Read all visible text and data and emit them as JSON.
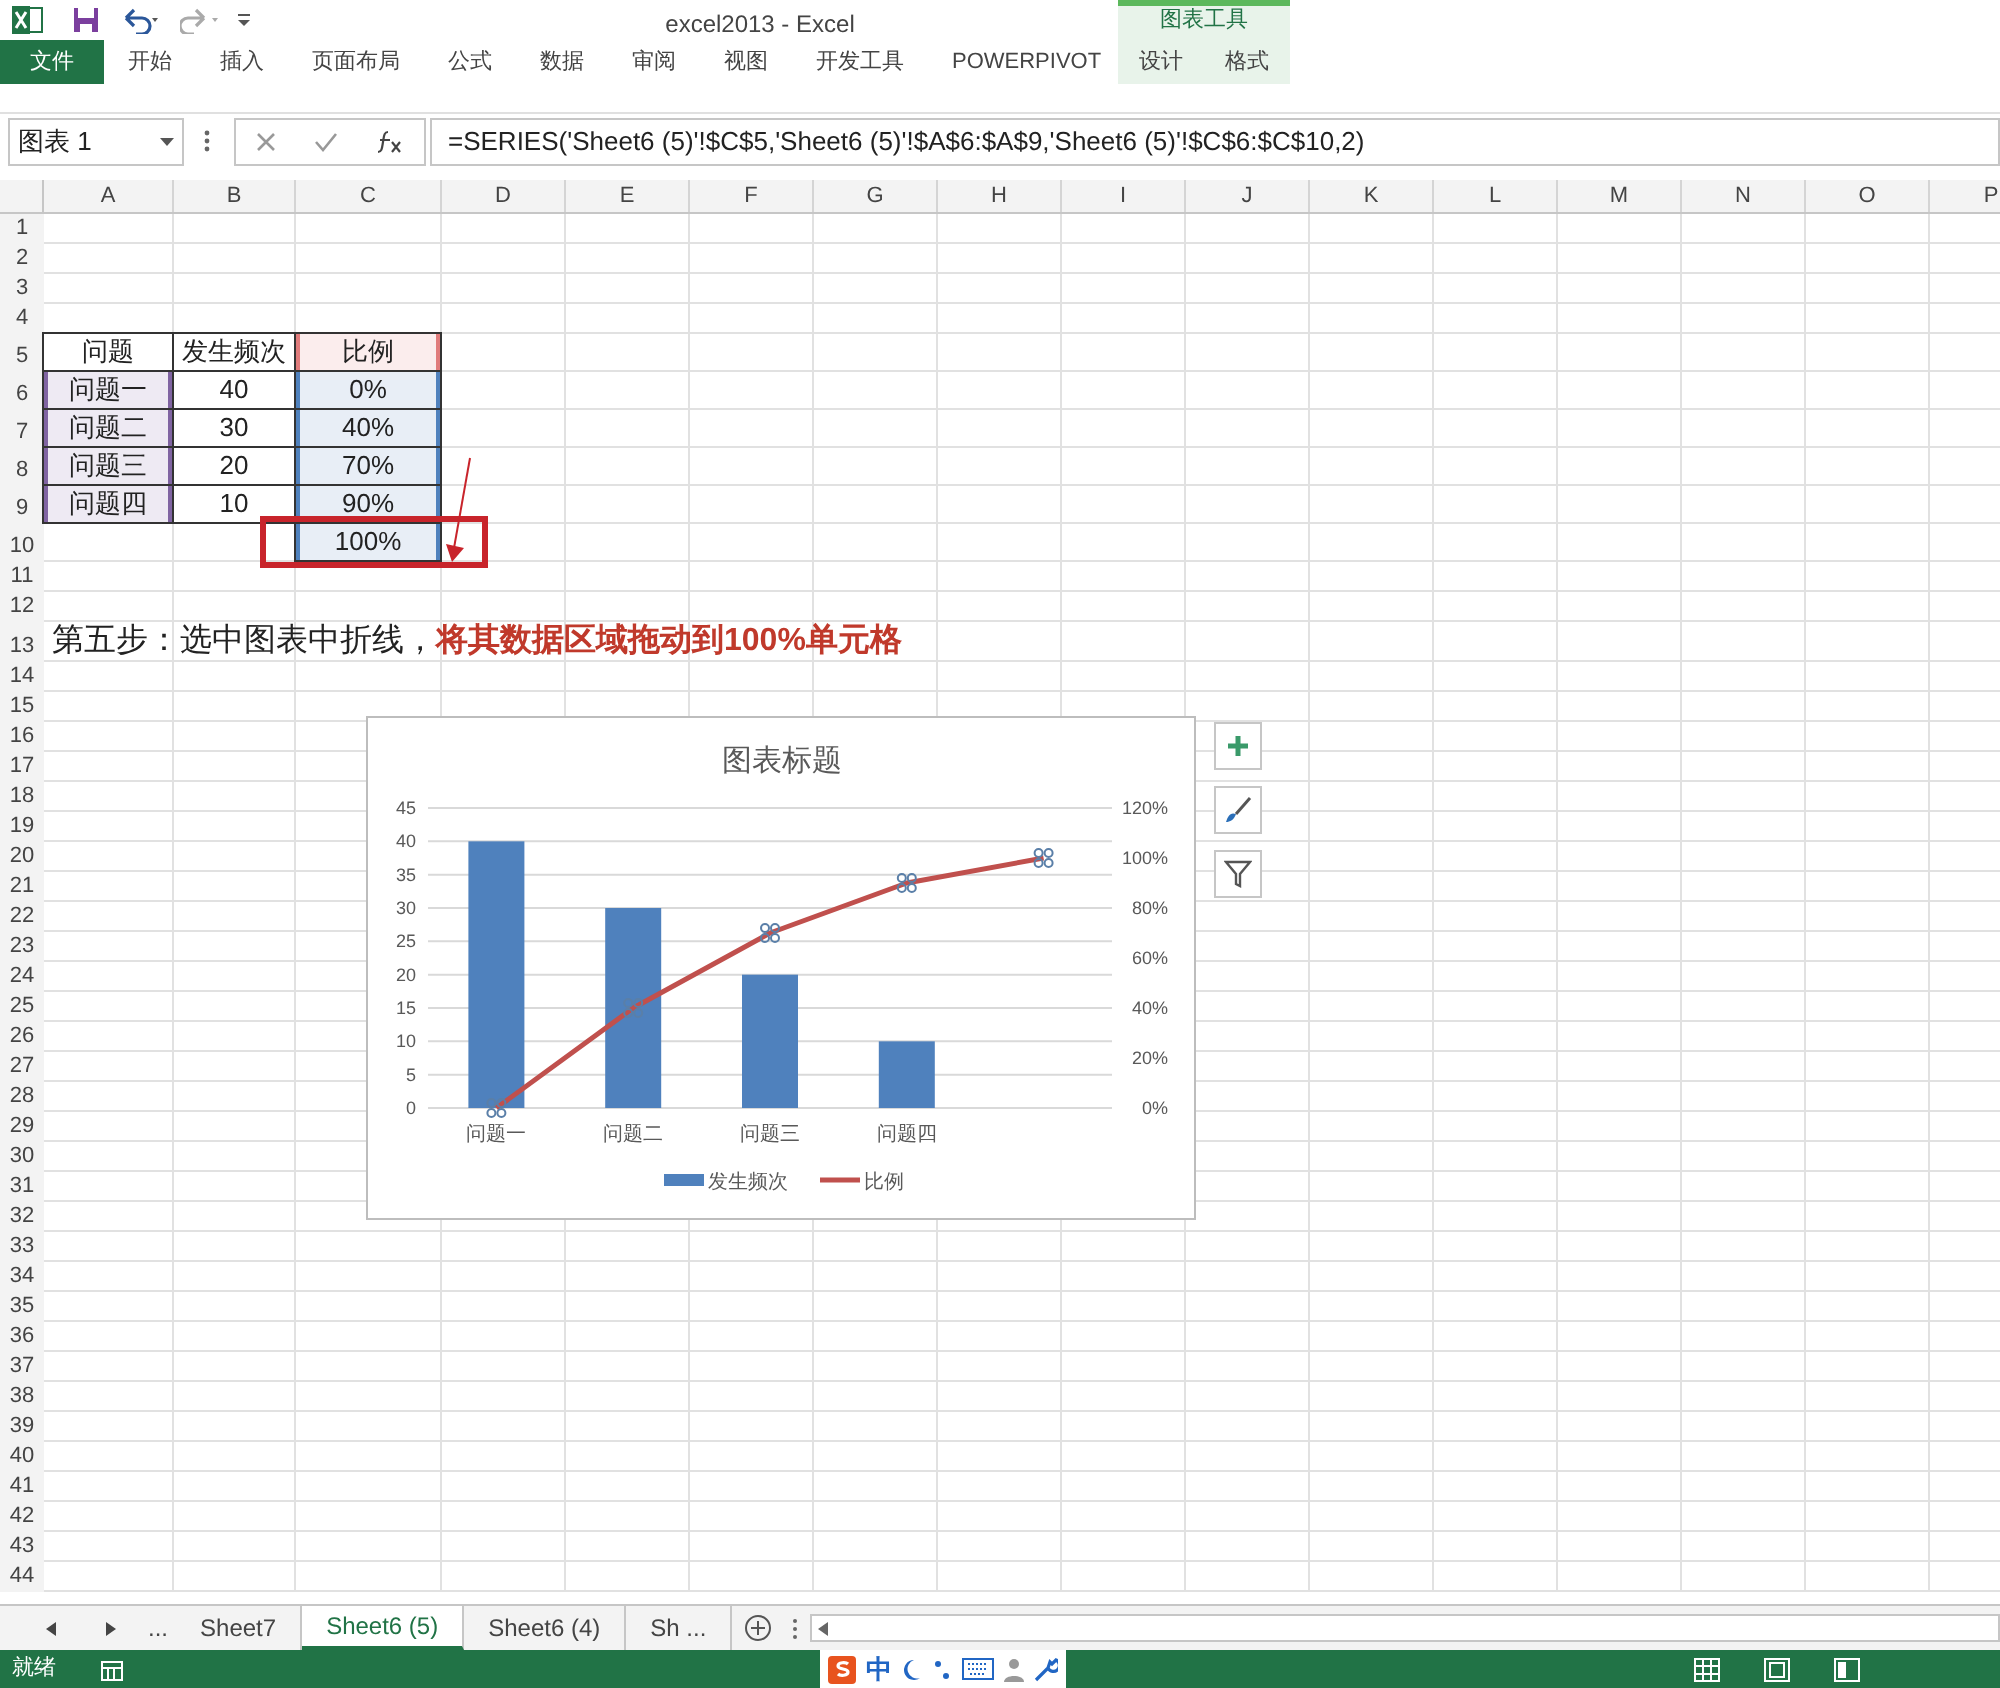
{
  "window": {
    "title": "excel2013 - Excel"
  },
  "ribbon": {
    "tabs": [
      {
        "label": "文件",
        "kind": "file",
        "selected": false
      },
      {
        "label": "开始",
        "kind": "tab",
        "selected": false
      },
      {
        "label": "插入",
        "kind": "tab",
        "selected": false
      },
      {
        "label": "页面布局",
        "kind": "tab",
        "selected": false
      },
      {
        "label": "公式",
        "kind": "tab",
        "selected": false
      },
      {
        "label": "数据",
        "kind": "tab",
        "selected": false
      },
      {
        "label": "审阅",
        "kind": "tab",
        "selected": false
      },
      {
        "label": "视图",
        "kind": "tab",
        "selected": false
      },
      {
        "label": "开发工具",
        "kind": "tab",
        "selected": false
      },
      {
        "label": "POWERPIVOT",
        "kind": "tab",
        "selected": false
      }
    ],
    "context_group": {
      "title": "图表工具",
      "tabs": [
        {
          "label": "设计",
          "selected": false
        },
        {
          "label": "格式",
          "selected": false
        }
      ]
    }
  },
  "formula_bar": {
    "name_box": "图表 1",
    "formula": "=SERIES('Sheet6 (5)'!$C$5,'Sheet6 (5)'!$A$6:$A$9,'Sheet6 (5)'!$C$6:$C$10,2)"
  },
  "sheet": {
    "columns": [
      "A",
      "B",
      "C",
      "D",
      "E",
      "F",
      "G",
      "H",
      "I",
      "J",
      "K",
      "L",
      "M",
      "N",
      "O",
      "P"
    ],
    "rows": [
      {
        "label": "1"
      },
      {
        "label": "2"
      },
      {
        "label": "3"
      },
      {
        "label": "4"
      },
      {
        "label": "5",
        "cells": [
          {
            "text": "问题"
          },
          {
            "text": "发生频次"
          },
          {
            "text": "比例",
            "color": "#e07b7b"
          }
        ]
      },
      {
        "label": "6",
        "cells": [
          {
            "text": "问题一",
            "color": "#8064a2"
          },
          {
            "text": "40"
          },
          {
            "text": "0%",
            "color": "#4f81bd"
          }
        ]
      },
      {
        "label": "7",
        "cells": [
          {
            "text": "问题二",
            "color": "#8064a2"
          },
          {
            "text": "30"
          },
          {
            "text": "40%",
            "color": "#4f81bd"
          }
        ]
      },
      {
        "label": "8",
        "cells": [
          {
            "text": "问题三",
            "color": "#8064a2"
          },
          {
            "text": "20"
          },
          {
            "text": "70%",
            "color": "#4f81bd"
          }
        ]
      },
      {
        "label": "9",
        "cells": [
          {
            "text": "问题四",
            "color": "#8064a2"
          },
          {
            "text": "10"
          },
          {
            "text": "90%",
            "color": "#4f81bd"
          }
        ]
      },
      {
        "label": "10",
        "cells": [
          {},
          {},
          {
            "text": "100%",
            "color": "#4f81bd"
          }
        ]
      },
      {
        "label": "11"
      },
      {
        "label": "12"
      },
      {
        "label": "13",
        "note": "第五步：选中图表中折线，**将其数据区域拖动到100%单元格**"
      },
      {
        "label": "14"
      },
      {
        "label": "15"
      },
      {
        "label": "16"
      },
      {
        "label": "17"
      },
      {
        "label": "18"
      },
      {
        "label": "19"
      },
      {
        "label": "20"
      },
      {
        "label": "21"
      },
      {
        "label": "22"
      },
      {
        "label": "23"
      },
      {
        "label": "24"
      },
      {
        "label": "25"
      },
      {
        "label": "26"
      },
      {
        "label": "27"
      },
      {
        "label": "28"
      },
      {
        "label": "29"
      },
      {
        "label": "30"
      },
      {
        "label": "31"
      },
      {
        "label": "32"
      },
      {
        "label": "33"
      },
      {
        "label": "34"
      },
      {
        "label": "35"
      },
      {
        "label": "36"
      },
      {
        "label": "37"
      },
      {
        "label": "38"
      },
      {
        "label": "39"
      },
      {
        "label": "40"
      },
      {
        "label": "41"
      },
      {
        "label": "42"
      },
      {
        "label": "43"
      },
      {
        "label": "44"
      }
    ]
  },
  "chart": {
    "bar_axis": {
      "chart_data": {
        "type": "bar",
        "title": "图表标题",
        "categories": [
          "问题一",
          "问题二",
          "问题三",
          "问题四",
          null
        ],
        "grid": true,
        "series": [
          {
            "name": "发生频次",
            "color": "#4f81bd",
            "values": [
              40,
              30,
              20,
              10,
              null
            ]
          }
        ],
        "ylim": [
          0,
          45
        ],
        "yticks": [
          0,
          5,
          10,
          15,
          20,
          25,
          30,
          35,
          40,
          45
        ]
      }
    },
    "line_axis": {
      "chart_data": {
        "type": "line",
        "series": [
          {
            "name": "比例",
            "color": "#c0504d",
            "values": [
              0,
              40,
              70,
              90,
              100
            ]
          }
        ],
        "ylim": [
          0,
          120
        ],
        "yticks": [
          {
            "value": 0,
            "label": "0%"
          },
          {
            "value": 20,
            "label": "20%"
          },
          {
            "value": 40,
            "label": "40%"
          },
          {
            "value": 60,
            "label": "60%"
          },
          {
            "value": 80,
            "label": "80%"
          },
          {
            "value": 100,
            "label": "100%"
          },
          {
            "value": 120,
            "label": "120%"
          }
        ]
      }
    }
  },
  "sheet_tabs": {
    "more_left": "...",
    "tabs": [
      {
        "label": "Sheet7",
        "selected": false
      },
      {
        "label": "Sheet6 (5)",
        "selected": true
      },
      {
        "label": "Sheet6 (4)",
        "selected": false
      },
      {
        "label": "Sh ...",
        "selected": false
      }
    ]
  },
  "status_bar": {
    "status": "就绪",
    "ime": "中"
  }
}
